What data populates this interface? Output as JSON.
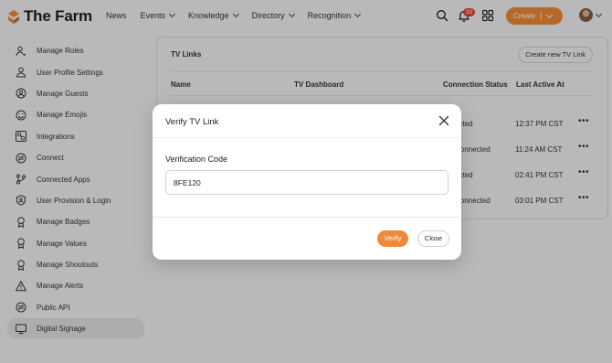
{
  "app": {
    "brand": "The Farm"
  },
  "nav": {
    "items": [
      {
        "label": "News",
        "has_dropdown": false
      },
      {
        "label": "Events",
        "has_dropdown": true
      },
      {
        "label": "Knowledge",
        "has_dropdown": true
      },
      {
        "label": "Directory",
        "has_dropdown": true
      },
      {
        "label": "Recognition",
        "has_dropdown": true
      }
    ],
    "notification_count": "33",
    "create_label": "Create",
    "icons": [
      "search-icon",
      "bell-icon",
      "apps-grid-icon"
    ]
  },
  "sidebar": {
    "items": [
      {
        "label": "Manage Roles",
        "icon": "user-key-icon",
        "active": false
      },
      {
        "label": "User Profile Settings",
        "icon": "user-icon",
        "active": false
      },
      {
        "label": "Manage Guests",
        "icon": "guest-icon",
        "active": false
      },
      {
        "label": "Manage Emojis",
        "icon": "smile-icon",
        "active": false
      },
      {
        "label": "Integrations",
        "icon": "integrations-icon",
        "active": false
      },
      {
        "label": "Connect",
        "icon": "connect-icon",
        "active": false
      },
      {
        "label": "Connected Apps",
        "icon": "branch-icon",
        "active": false
      },
      {
        "label": "User Provision & Login",
        "icon": "shield-user-icon",
        "active": false
      },
      {
        "label": "Manage Badges",
        "icon": "badge-icon",
        "active": false
      },
      {
        "label": "Manage Values",
        "icon": "values-icon",
        "active": false
      },
      {
        "label": "Manage Shoutouts",
        "icon": "shoutout-icon",
        "active": false
      },
      {
        "label": "Manage Alerts",
        "icon": "alert-icon",
        "active": false
      },
      {
        "label": "Public API",
        "icon": "api-icon",
        "active": false
      },
      {
        "label": "Digital Signage",
        "icon": "monitor-icon",
        "active": true
      }
    ]
  },
  "tv_links": {
    "title": "TV Links",
    "create_button": "Create new TV Link",
    "columns": [
      "Name",
      "TV Dashboard",
      "Connection Status",
      "Last Active At"
    ],
    "rows": [
      {
        "status": "ected",
        "last_active": "12:37 PM CST"
      },
      {
        "status": "Connected",
        "last_active": "11:24 AM CST"
      },
      {
        "status": "ected",
        "last_active": "02:41 PM CST"
      },
      {
        "status": "Connected",
        "last_active": "03:01 PM CST"
      }
    ],
    "row_menu": "•••"
  },
  "modal": {
    "title": "Verify TV Link",
    "field_label": "Verification Code",
    "field_value": "8FE120",
    "verify_button": "Verify",
    "close_button": "Close"
  },
  "colors": {
    "accent": "#EE8A35",
    "badge": "#E8452F",
    "background": "#F4F4F6"
  }
}
